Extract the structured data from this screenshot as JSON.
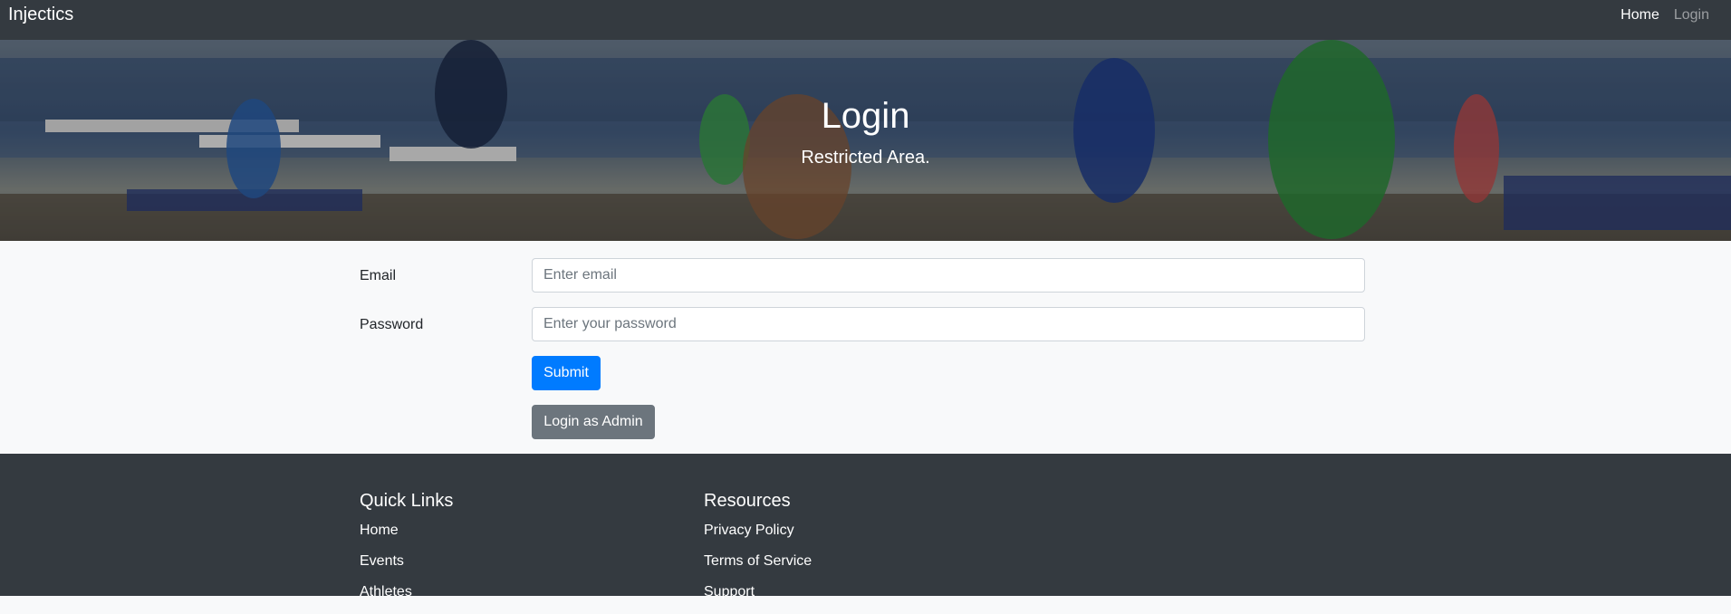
{
  "navbar": {
    "brand": "Injectics",
    "links": [
      {
        "label": "Home"
      },
      {
        "label": "Login"
      }
    ]
  },
  "hero": {
    "title": "Login",
    "subtitle": "Restricted Area."
  },
  "form": {
    "email_label": "Email",
    "email_placeholder": "Enter email",
    "email_value": "",
    "password_label": "Password",
    "password_placeholder": "Enter your password",
    "password_value": "",
    "submit_label": "Submit",
    "admin_label": "Login as Admin"
  },
  "footer": {
    "quick_links": {
      "heading": "Quick Links",
      "items": [
        "Home",
        "Events",
        "Athletes"
      ]
    },
    "resources": {
      "heading": "Resources",
      "items": [
        "Privacy Policy",
        "Terms of Service",
        "Support"
      ]
    }
  },
  "colors": {
    "navbar_bg": "#343a40",
    "primary": "#007bff",
    "secondary": "#6c757d",
    "form_bg": "#f8f9fa"
  }
}
